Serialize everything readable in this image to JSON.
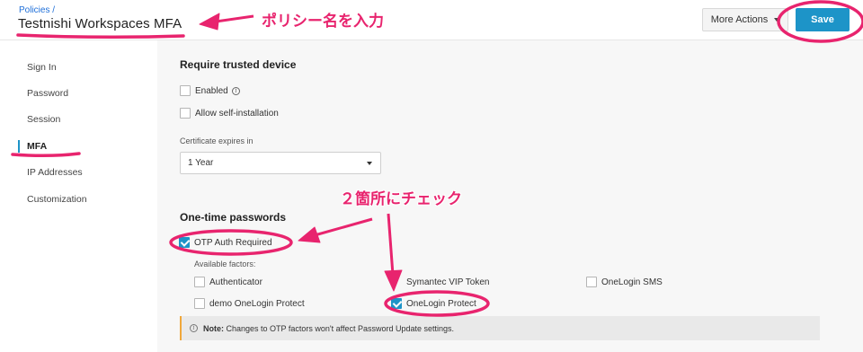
{
  "header": {
    "breadcrumb": "Policies /",
    "title": "Testnishi Workspaces MFA",
    "more_actions_label": "More Actions",
    "save_label": "Save"
  },
  "sidebar": {
    "items": [
      {
        "label": "Sign In"
      },
      {
        "label": "Password"
      },
      {
        "label": "Session"
      },
      {
        "label": "MFA",
        "active": true
      },
      {
        "label": "IP Addresses"
      },
      {
        "label": "Customization"
      }
    ]
  },
  "trusted_device": {
    "title": "Require trusted device",
    "enabled_label": "Enabled",
    "enabled_checked": false,
    "self_install_label": "Allow self-installation",
    "self_install_checked": false,
    "cert_expires_label": "Certificate expires in",
    "cert_expires_value": "1 Year"
  },
  "otp": {
    "title": "One-time passwords",
    "required_label": "OTP Auth Required",
    "required_checked": true,
    "available_factors_label": "Available factors:",
    "factors": [
      {
        "label": "Authenticator",
        "checked": false
      },
      {
        "label": "Symantec VIP Token",
        "checked": false
      },
      {
        "label": "OneLogin SMS",
        "checked": false
      },
      {
        "label": "demo OneLogin Protect",
        "checked": false
      },
      {
        "label": "OneLogin Protect",
        "checked": true
      }
    ]
  },
  "note": {
    "bold": "Note:",
    "text": "Changes to OTP factors won't affect Password Update settings."
  },
  "annotations": {
    "policy_name": "ポリシー名を入力",
    "check_two": "２箇所にチェック",
    "color": "#e8246e"
  },
  "colors": {
    "accent": "#1d94c8",
    "note_border": "#f0a73a",
    "annotation": "#e8246e"
  }
}
